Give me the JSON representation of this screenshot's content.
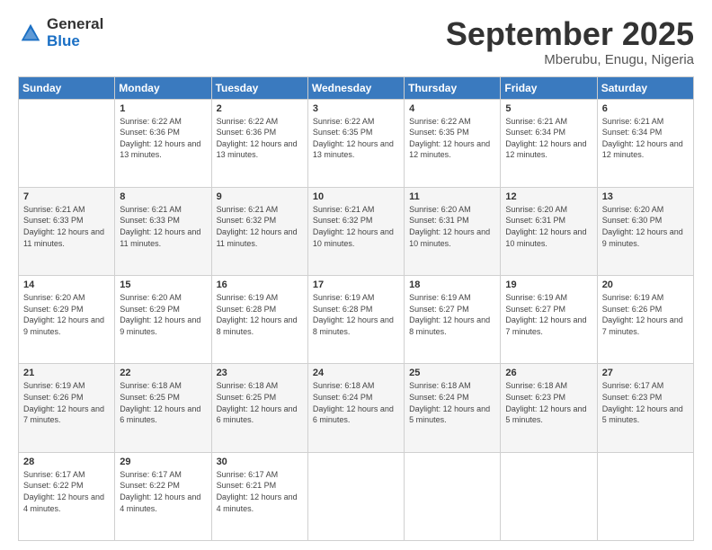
{
  "logo": {
    "general": "General",
    "blue": "Blue"
  },
  "header": {
    "month": "September 2025",
    "location": "Mberubu, Enugu, Nigeria"
  },
  "weekdays": [
    "Sunday",
    "Monday",
    "Tuesday",
    "Wednesday",
    "Thursday",
    "Friday",
    "Saturday"
  ],
  "weeks": [
    [
      {
        "day": "",
        "sunrise": "",
        "sunset": "",
        "daylight": ""
      },
      {
        "day": "1",
        "sunrise": "Sunrise: 6:22 AM",
        "sunset": "Sunset: 6:36 PM",
        "daylight": "Daylight: 12 hours and 13 minutes."
      },
      {
        "day": "2",
        "sunrise": "Sunrise: 6:22 AM",
        "sunset": "Sunset: 6:36 PM",
        "daylight": "Daylight: 12 hours and 13 minutes."
      },
      {
        "day": "3",
        "sunrise": "Sunrise: 6:22 AM",
        "sunset": "Sunset: 6:35 PM",
        "daylight": "Daylight: 12 hours and 13 minutes."
      },
      {
        "day": "4",
        "sunrise": "Sunrise: 6:22 AM",
        "sunset": "Sunset: 6:35 PM",
        "daylight": "Daylight: 12 hours and 12 minutes."
      },
      {
        "day": "5",
        "sunrise": "Sunrise: 6:21 AM",
        "sunset": "Sunset: 6:34 PM",
        "daylight": "Daylight: 12 hours and 12 minutes."
      },
      {
        "day": "6",
        "sunrise": "Sunrise: 6:21 AM",
        "sunset": "Sunset: 6:34 PM",
        "daylight": "Daylight: 12 hours and 12 minutes."
      }
    ],
    [
      {
        "day": "7",
        "sunrise": "Sunrise: 6:21 AM",
        "sunset": "Sunset: 6:33 PM",
        "daylight": "Daylight: 12 hours and 11 minutes."
      },
      {
        "day": "8",
        "sunrise": "Sunrise: 6:21 AM",
        "sunset": "Sunset: 6:33 PM",
        "daylight": "Daylight: 12 hours and 11 minutes."
      },
      {
        "day": "9",
        "sunrise": "Sunrise: 6:21 AM",
        "sunset": "Sunset: 6:32 PM",
        "daylight": "Daylight: 12 hours and 11 minutes."
      },
      {
        "day": "10",
        "sunrise": "Sunrise: 6:21 AM",
        "sunset": "Sunset: 6:32 PM",
        "daylight": "Daylight: 12 hours and 10 minutes."
      },
      {
        "day": "11",
        "sunrise": "Sunrise: 6:20 AM",
        "sunset": "Sunset: 6:31 PM",
        "daylight": "Daylight: 12 hours and 10 minutes."
      },
      {
        "day": "12",
        "sunrise": "Sunrise: 6:20 AM",
        "sunset": "Sunset: 6:31 PM",
        "daylight": "Daylight: 12 hours and 10 minutes."
      },
      {
        "day": "13",
        "sunrise": "Sunrise: 6:20 AM",
        "sunset": "Sunset: 6:30 PM",
        "daylight": "Daylight: 12 hours and 9 minutes."
      }
    ],
    [
      {
        "day": "14",
        "sunrise": "Sunrise: 6:20 AM",
        "sunset": "Sunset: 6:29 PM",
        "daylight": "Daylight: 12 hours and 9 minutes."
      },
      {
        "day": "15",
        "sunrise": "Sunrise: 6:20 AM",
        "sunset": "Sunset: 6:29 PM",
        "daylight": "Daylight: 12 hours and 9 minutes."
      },
      {
        "day": "16",
        "sunrise": "Sunrise: 6:19 AM",
        "sunset": "Sunset: 6:28 PM",
        "daylight": "Daylight: 12 hours and 8 minutes."
      },
      {
        "day": "17",
        "sunrise": "Sunrise: 6:19 AM",
        "sunset": "Sunset: 6:28 PM",
        "daylight": "Daylight: 12 hours and 8 minutes."
      },
      {
        "day": "18",
        "sunrise": "Sunrise: 6:19 AM",
        "sunset": "Sunset: 6:27 PM",
        "daylight": "Daylight: 12 hours and 8 minutes."
      },
      {
        "day": "19",
        "sunrise": "Sunrise: 6:19 AM",
        "sunset": "Sunset: 6:27 PM",
        "daylight": "Daylight: 12 hours and 7 minutes."
      },
      {
        "day": "20",
        "sunrise": "Sunrise: 6:19 AM",
        "sunset": "Sunset: 6:26 PM",
        "daylight": "Daylight: 12 hours and 7 minutes."
      }
    ],
    [
      {
        "day": "21",
        "sunrise": "Sunrise: 6:19 AM",
        "sunset": "Sunset: 6:26 PM",
        "daylight": "Daylight: 12 hours and 7 minutes."
      },
      {
        "day": "22",
        "sunrise": "Sunrise: 6:18 AM",
        "sunset": "Sunset: 6:25 PM",
        "daylight": "Daylight: 12 hours and 6 minutes."
      },
      {
        "day": "23",
        "sunrise": "Sunrise: 6:18 AM",
        "sunset": "Sunset: 6:25 PM",
        "daylight": "Daylight: 12 hours and 6 minutes."
      },
      {
        "day": "24",
        "sunrise": "Sunrise: 6:18 AM",
        "sunset": "Sunset: 6:24 PM",
        "daylight": "Daylight: 12 hours and 6 minutes."
      },
      {
        "day": "25",
        "sunrise": "Sunrise: 6:18 AM",
        "sunset": "Sunset: 6:24 PM",
        "daylight": "Daylight: 12 hours and 5 minutes."
      },
      {
        "day": "26",
        "sunrise": "Sunrise: 6:18 AM",
        "sunset": "Sunset: 6:23 PM",
        "daylight": "Daylight: 12 hours and 5 minutes."
      },
      {
        "day": "27",
        "sunrise": "Sunrise: 6:17 AM",
        "sunset": "Sunset: 6:23 PM",
        "daylight": "Daylight: 12 hours and 5 minutes."
      }
    ],
    [
      {
        "day": "28",
        "sunrise": "Sunrise: 6:17 AM",
        "sunset": "Sunset: 6:22 PM",
        "daylight": "Daylight: 12 hours and 4 minutes."
      },
      {
        "day": "29",
        "sunrise": "Sunrise: 6:17 AM",
        "sunset": "Sunset: 6:22 PM",
        "daylight": "Daylight: 12 hours and 4 minutes."
      },
      {
        "day": "30",
        "sunrise": "Sunrise: 6:17 AM",
        "sunset": "Sunset: 6:21 PM",
        "daylight": "Daylight: 12 hours and 4 minutes."
      },
      {
        "day": "",
        "sunrise": "",
        "sunset": "",
        "daylight": ""
      },
      {
        "day": "",
        "sunrise": "",
        "sunset": "",
        "daylight": ""
      },
      {
        "day": "",
        "sunrise": "",
        "sunset": "",
        "daylight": ""
      },
      {
        "day": "",
        "sunrise": "",
        "sunset": "",
        "daylight": ""
      }
    ]
  ]
}
